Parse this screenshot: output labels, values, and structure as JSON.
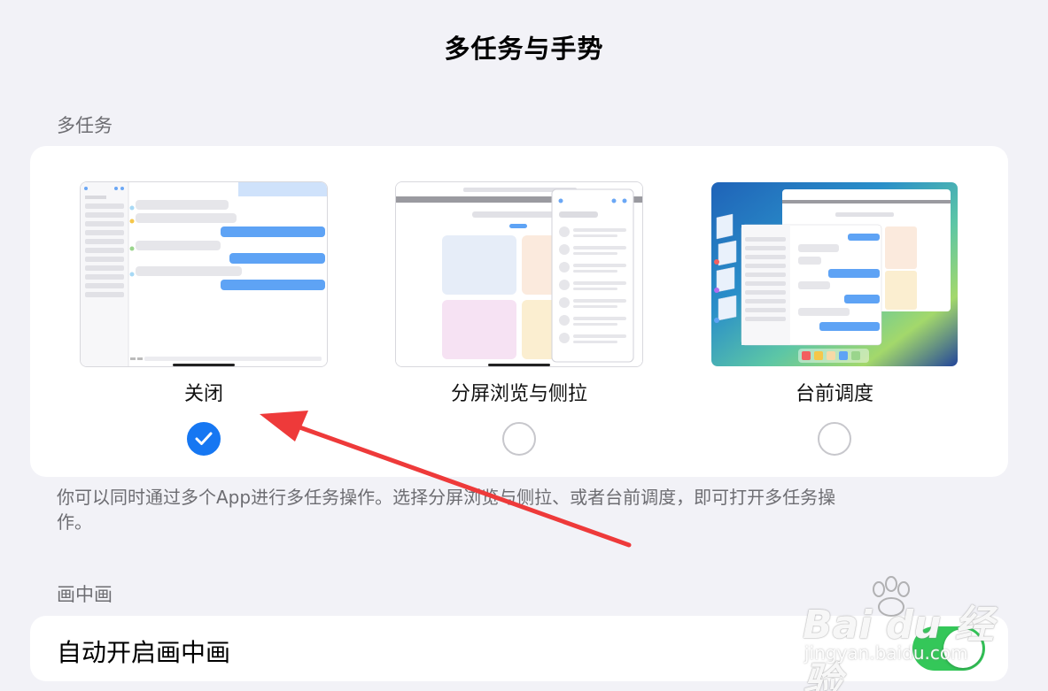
{
  "header": {
    "title": "多任务与手势"
  },
  "multitasking": {
    "section_label": "多任务",
    "options": [
      {
        "label": "关闭",
        "selected": true
      },
      {
        "label": "分屏浏览与侧拉",
        "selected": false
      },
      {
        "label": "台前调度",
        "selected": false
      }
    ],
    "footnote": "你可以同时通过多个App进行多任务操作。选择分屏浏览与侧拉、或者台前调度，即可打开多任务操作。"
  },
  "pip": {
    "section_label": "画中画",
    "row_label": "自动开启画中画",
    "toggle_on": true
  },
  "colors": {
    "accent": "#1677f2",
    "toggle_on": "#34c759",
    "annotation_arrow": "#ee3a3a"
  },
  "watermark": {
    "brand": "Bai du 经验",
    "url": "jingyan.baidu.com"
  }
}
